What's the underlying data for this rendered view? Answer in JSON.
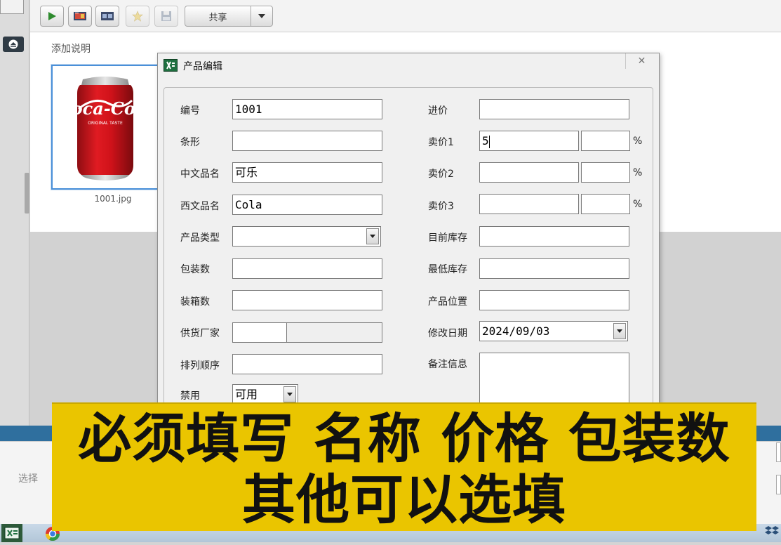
{
  "toolbar": {
    "share_label": "共享",
    "buttons": [
      "play-icon",
      "add-photo-icon",
      "slideshow-icon",
      "star-icon",
      "save-icon"
    ]
  },
  "viewer": {
    "caption_label": "添加说明",
    "thumbnail_name": "1001.jpg",
    "thumbnail_alt": "Coca-Cola"
  },
  "dialog": {
    "title": "产品编辑",
    "close_glyph": "✕",
    "labels": {
      "code": "编号",
      "barcode": "条形",
      "name_cn": "中文品名",
      "name_west": "西文品名",
      "category": "产品类型",
      "pack_qty": "包装数",
      "box_qty": "装箱数",
      "supplier": "供货厂家",
      "sort_order": "排列顺序",
      "disabled": "禁用",
      "cost": "进价",
      "price1": "卖价1",
      "price2": "卖价2",
      "price3": "卖价3",
      "stock": "目前库存",
      "min_stock": "最低库存",
      "location": "产品位置",
      "modified": "修改日期",
      "notes": "备注信息"
    },
    "values": {
      "code": "1001",
      "barcode": "",
      "name_cn": "可乐",
      "name_west": "Cola",
      "category": "",
      "pack_qty": "",
      "box_qty": "",
      "supplier_code": "",
      "supplier_name": "",
      "sort_order": "",
      "disabled": "可用",
      "cost": "",
      "price1": "5",
      "price1_pct": "",
      "price2": "",
      "price2_pct": "",
      "price3": "",
      "price3_pct": "",
      "stock": "",
      "min_stock": "",
      "location": "",
      "modified": "2024/09/03",
      "notes": ""
    },
    "percent_sign": "%"
  },
  "bottom": {
    "select_label": "选择"
  },
  "banner": {
    "line1": "必须填写 名称 价格 包装数",
    "line2": "其他可以选填"
  },
  "colors": {
    "banner_bg": "#eac500",
    "taskbar_blue": "#2f6f9e",
    "selection_border": "#4a90d9"
  }
}
